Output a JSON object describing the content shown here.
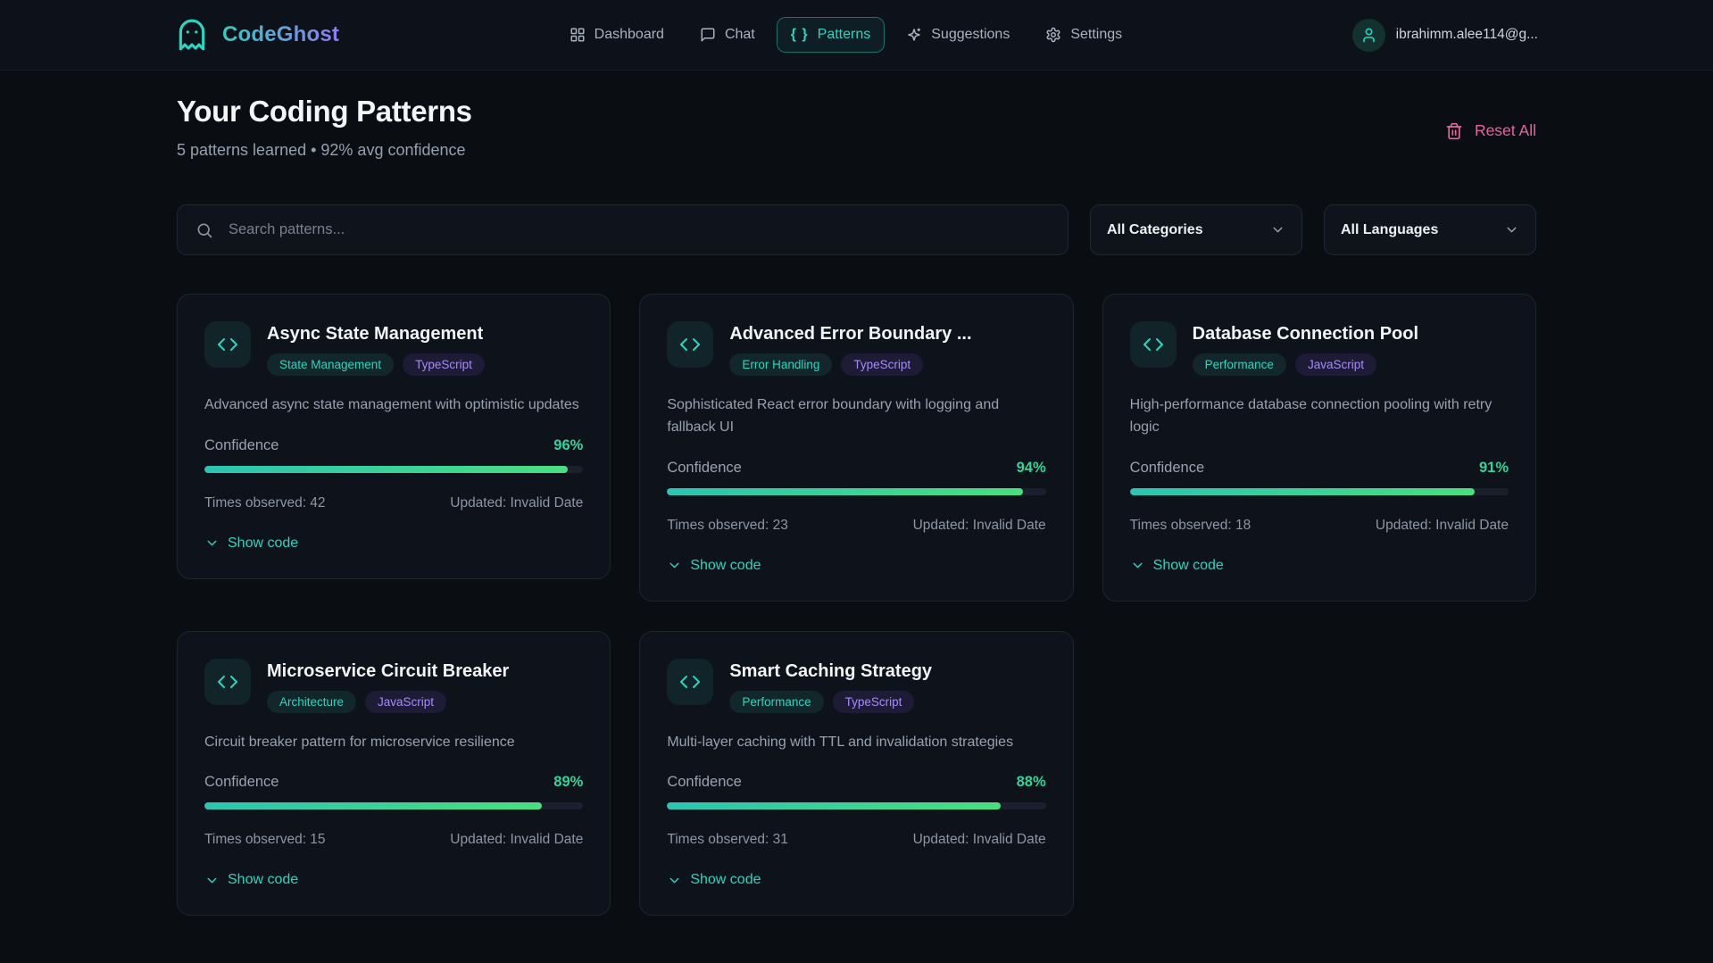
{
  "brand": {
    "name": "CodeGhost"
  },
  "nav": [
    {
      "label": "Dashboard",
      "icon": "dashboard-grid-icon",
      "active": false
    },
    {
      "label": "Chat",
      "icon": "chat-bubble-icon",
      "active": false
    },
    {
      "label": "Patterns",
      "icon": "braces-icon",
      "active": true
    },
    {
      "label": "Suggestions",
      "icon": "sparkles-icon",
      "active": false
    },
    {
      "label": "Settings",
      "icon": "gear-icon",
      "active": false
    }
  ],
  "user": {
    "email": "ibrahimm.alee114@g..."
  },
  "page": {
    "title": "Your Coding Patterns",
    "subtitle": "5 patterns learned • 92% avg confidence",
    "reset_label": "Reset All"
  },
  "filters": {
    "search_placeholder": "Search patterns...",
    "category_selected": "All Categories",
    "language_selected": "All Languages"
  },
  "card_labels": {
    "confidence": "Confidence",
    "show_code": "Show code"
  },
  "patterns": [
    {
      "title": "Async State Management",
      "category": "State Management",
      "language": "TypeScript",
      "description": "Advanced async state management with optimistic updates",
      "confidence": "96%",
      "confidence_pct": 96,
      "times_observed_text": "Times observed: 42",
      "updated_text": "Updated: Invalid Date"
    },
    {
      "title": "Advanced Error Boundary ...",
      "category": "Error Handling",
      "language": "TypeScript",
      "description": "Sophisticated React error boundary with logging and fallback UI",
      "confidence": "94%",
      "confidence_pct": 94,
      "times_observed_text": "Times observed: 23",
      "updated_text": "Updated: Invalid Date"
    },
    {
      "title": "Database Connection Pool",
      "category": "Performance",
      "language": "JavaScript",
      "description": "High-performance database connection pooling with retry logic",
      "confidence": "91%",
      "confidence_pct": 91,
      "times_observed_text": "Times observed: 18",
      "updated_text": "Updated: Invalid Date"
    },
    {
      "title": "Microservice Circuit Breaker",
      "category": "Architecture",
      "language": "JavaScript",
      "description": "Circuit breaker pattern for microservice resilience",
      "confidence": "89%",
      "confidence_pct": 89,
      "times_observed_text": "Times observed: 15",
      "updated_text": "Updated: Invalid Date"
    },
    {
      "title": "Smart Caching Strategy",
      "category": "Performance",
      "language": "TypeScript",
      "description": "Multi-layer caching with TTL and invalidation strategies",
      "confidence": "88%",
      "confidence_pct": 88,
      "times_observed_text": "Times observed: 31",
      "updated_text": "Updated: Invalid Date"
    }
  ],
  "colors": {
    "accent_teal": "#2dd4bf",
    "badge_purple": "#a78bfa",
    "confidence_green": "#34d399",
    "danger_pink": "#e2689d",
    "progress_gradient_start": "#2cc4b2",
    "progress_gradient_end": "#4ade80"
  }
}
